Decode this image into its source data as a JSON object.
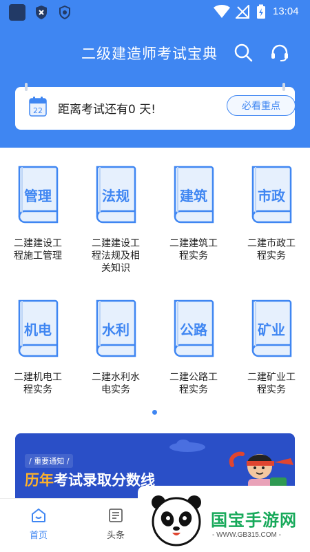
{
  "status_bar": {
    "time": "13:04"
  },
  "header": {
    "title": "二级建造师考试宝典",
    "search_icon": "search-icon",
    "support_icon": "headset-icon"
  },
  "countdown": {
    "calendar_day": "22",
    "text": "距离考试还有0 天!",
    "button_label": "必看重点"
  },
  "subjects": [
    {
      "badge": "管理",
      "name_line1": "二建建设工",
      "name_line2": "程施工管理",
      "name_line3": ""
    },
    {
      "badge": "法规",
      "name_line1": "二建建设工",
      "name_line2": "程法规及相",
      "name_line3": "关知识"
    },
    {
      "badge": "建筑",
      "name_line1": "二建建筑工",
      "name_line2": "程实务",
      "name_line3": ""
    },
    {
      "badge": "市政",
      "name_line1": "二建市政工",
      "name_line2": "程实务",
      "name_line3": ""
    },
    {
      "badge": "机电",
      "name_line1": "二建机电工",
      "name_line2": "程实务",
      "name_line3": ""
    },
    {
      "badge": "水利",
      "name_line1": "二建水利水",
      "name_line2": "电实务",
      "name_line3": ""
    },
    {
      "badge": "公路",
      "name_line1": "二建公路工",
      "name_line2": "程实务",
      "name_line3": ""
    },
    {
      "badge": "矿业",
      "name_line1": "二建矿业工",
      "name_line2": "程实务",
      "name_line3": ""
    }
  ],
  "banner": {
    "notice": "/ 重要通知 /",
    "title_highlight": "历年",
    "title_rest": "考试录取分数线"
  },
  "bottom_nav": {
    "home_label": "首页",
    "news_label": "头条"
  },
  "watermark": {
    "brand": "国宝手游网",
    "url": "- WWW.GB315.COM -"
  },
  "colors": {
    "primary": "#3f86f2",
    "banner": "#2a4fc7",
    "watermark_green": "#17a95a"
  }
}
